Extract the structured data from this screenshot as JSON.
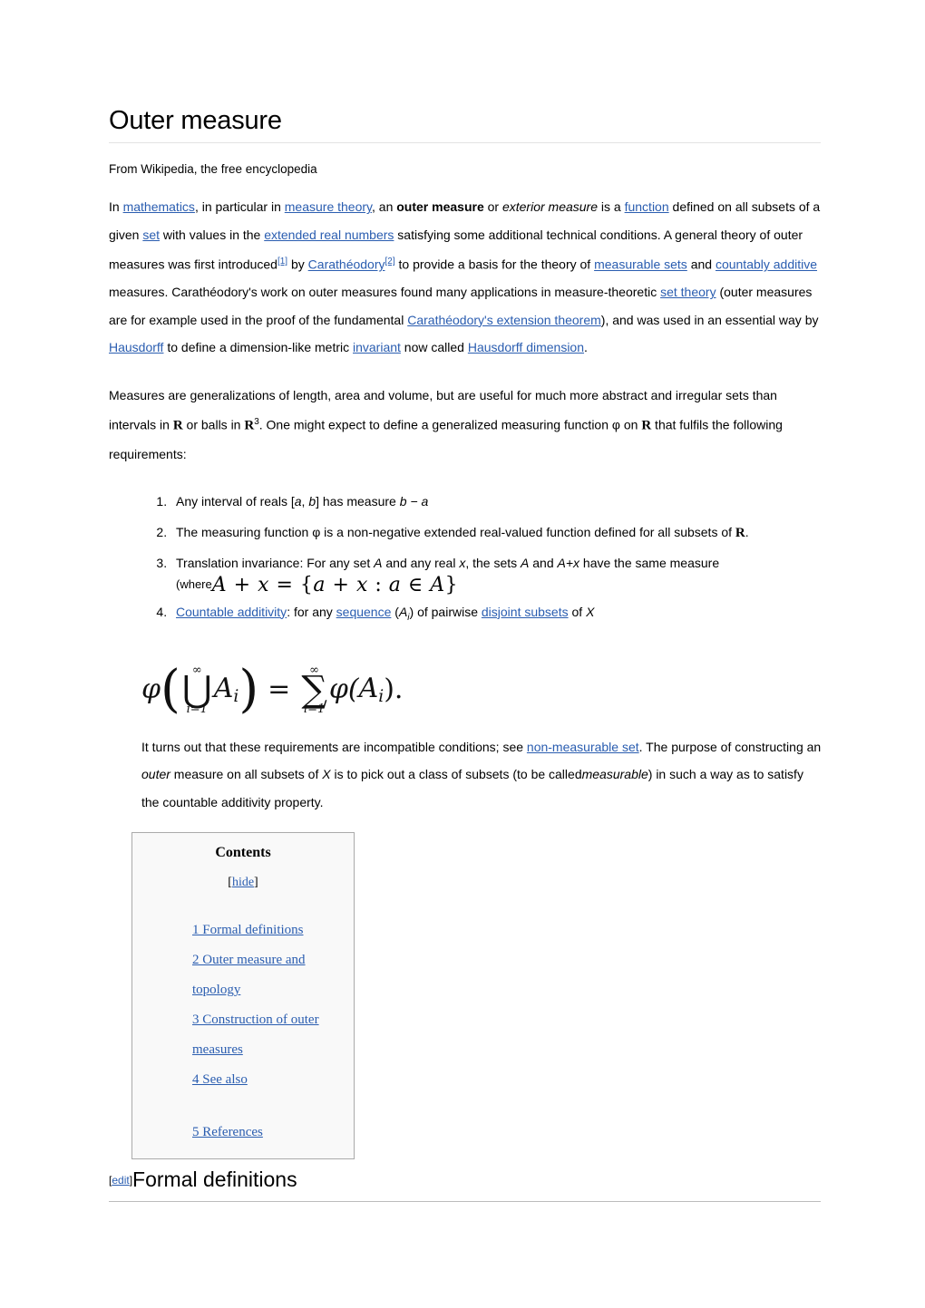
{
  "article": {
    "title": "Outer measure",
    "tagline": "From Wikipedia, the free encyclopedia"
  },
  "paragraph1": {
    "t1": "In ",
    "l1": "mathematics",
    "t2": ", in particular in ",
    "l2": "measure theory",
    "t3": ", an ",
    "bold1": "outer measure",
    "t4": " or ",
    "ital1": "exterior measure",
    "t5": " is a ",
    "l3": "function",
    "t6": " defined on all subsets of a given ",
    "l4": "set",
    "t7": " with values in the ",
    "l5": "extended real numbers",
    "t8": " satisfying some additional technical conditions. A general theory of outer measures was first introduced",
    "ref1": "[1]",
    "t9": " by ",
    "l6": "Carathéodory",
    "ref2": "[2]",
    "t10": " to provide a basis for the theory of ",
    "l7": "measurable sets",
    "t11": " and ",
    "l8": "countably additive",
    "t12": " measures. Carathéodory's work on outer measures found many applications in measure-theoretic ",
    "l9": "set theory",
    "t13": " (outer measures are for example used in the proof of the fundamental ",
    "l10": "Carathéodory's extension theorem",
    "t14": "), and was used in an essential way by ",
    "l11": "Hausdorff",
    "t15": " to define a dimension-like metric ",
    "l12": "invariant",
    "t16": " now called ",
    "l13": "Hausdorff dimension",
    "t17": "."
  },
  "paragraph2": {
    "t1": "Measures are generalizations of length, area and volume, but are useful for much more abstract and irregular sets than intervals in ",
    "r1": "R",
    "t2": " or balls in ",
    "r2": "R",
    "sup": "3",
    "t3": ". One might expect to define a generalized measuring function φ on ",
    "r3": "R",
    "t4": " that fulfils the following requirements:"
  },
  "requirements": {
    "item1": {
      "t1": "Any interval of reals [",
      "a": "a",
      "t2": ", ",
      "b": "b",
      "t3": "] has measure ",
      "formula": "b − a"
    },
    "item2": {
      "t1": "The measuring function φ is a non-negative extended real-valued function defined for all subsets of ",
      "r": "R",
      "t2": "."
    },
    "item3": {
      "t1": "Translation invariance: For any set ",
      "a1": "A",
      "t2": " and any real ",
      "x1": "x",
      "t3": ", the sets ",
      "a2": "A",
      "t4": " and ",
      "ax": "A+x",
      "t5": " have the same measure",
      "where": "(where",
      "math": "A + x = {a + x : a ∈ A}"
    },
    "item4": {
      "l1": "Countable additivity",
      "t1": ": for any ",
      "l2": "sequence",
      "t2": " (",
      "a": "A",
      "sub": "i",
      "t3": ") of pairwise ",
      "l3": "disjoint subsets",
      "t4": " of ",
      "x": "X"
    }
  },
  "display_formula": {
    "phi_left": "φ",
    "union": "⋃",
    "union_top": "∞",
    "union_bottom": "i=1",
    "union_arg": "A",
    "union_arg_sub": "i",
    "equals": "=",
    "sigma": "∑",
    "sigma_top": "∞",
    "sigma_bottom": "i=1",
    "phi_right": "φ(",
    "sum_arg": "A",
    "sum_arg_sub": "i",
    "tail": ")."
  },
  "paragraph3": {
    "t1": "It turns out that these requirements are incompatible conditions; see ",
    "l1": "non-measurable set",
    "t2": ". The purpose of constructing an ",
    "ital1": "outer",
    "t3": " measure on all subsets of ",
    "x": "X",
    "t4": " is to pick out a class of subsets (to be called",
    "ital2": "measurable",
    "t5": ") in such a way as to satisfy the countable additivity property."
  },
  "toc": {
    "title": "Contents",
    "bracket_open": "[",
    "hide": "hide",
    "bracket_close": "]",
    "items": [
      {
        "label": "1 Formal definitions"
      },
      {
        "label": "2 Outer measure and topology"
      },
      {
        "label": "3 Construction of outer measures"
      },
      {
        "label": "4 See also"
      },
      {
        "label": "5 References"
      }
    ]
  },
  "section": {
    "bracket_open": "[",
    "edit": "edit",
    "bracket_close": "]",
    "heading": "Formal definitions"
  },
  "colors": {
    "link": "#2a5db0",
    "toc_border": "#aaaaaa",
    "toc_background": "#f9f9f9",
    "title_rule": "#e3e3e3",
    "section_rule": "#bcbcbc"
  }
}
